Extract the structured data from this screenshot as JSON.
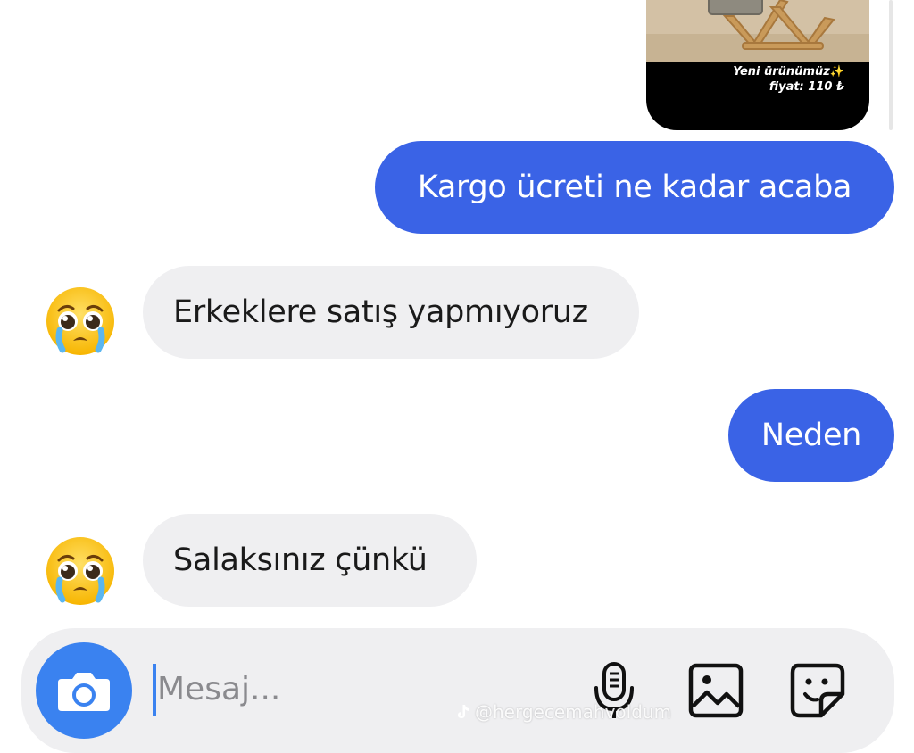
{
  "shared_post": {
    "caption_line1": "Yeni ürünümüz",
    "caption_line1_suffix": "✨",
    "caption_line2": "fiyat: 110 ₺"
  },
  "messages": [
    {
      "direction": "outgoing",
      "text": "Kargo ücreti ne kadar acaba"
    },
    {
      "direction": "incoming",
      "text": "Erkeklere satış yapmıyoruz"
    },
    {
      "direction": "outgoing",
      "text": "Neden"
    },
    {
      "direction": "incoming",
      "text": "Salaksınız çünkü"
    }
  ],
  "composer": {
    "placeholder": "Mesaj..."
  },
  "icons": {
    "camera": "camera-icon",
    "mic": "microphone-icon",
    "gallery": "gallery-icon",
    "sticker": "sticker-icon",
    "avatar": "pleading-face-emoji"
  },
  "watermark": "@hergecemahvoldum",
  "colors": {
    "outgoing_bubble": "#3a63e6",
    "incoming_bubble": "#efeff1",
    "accent": "#3a82f0"
  }
}
